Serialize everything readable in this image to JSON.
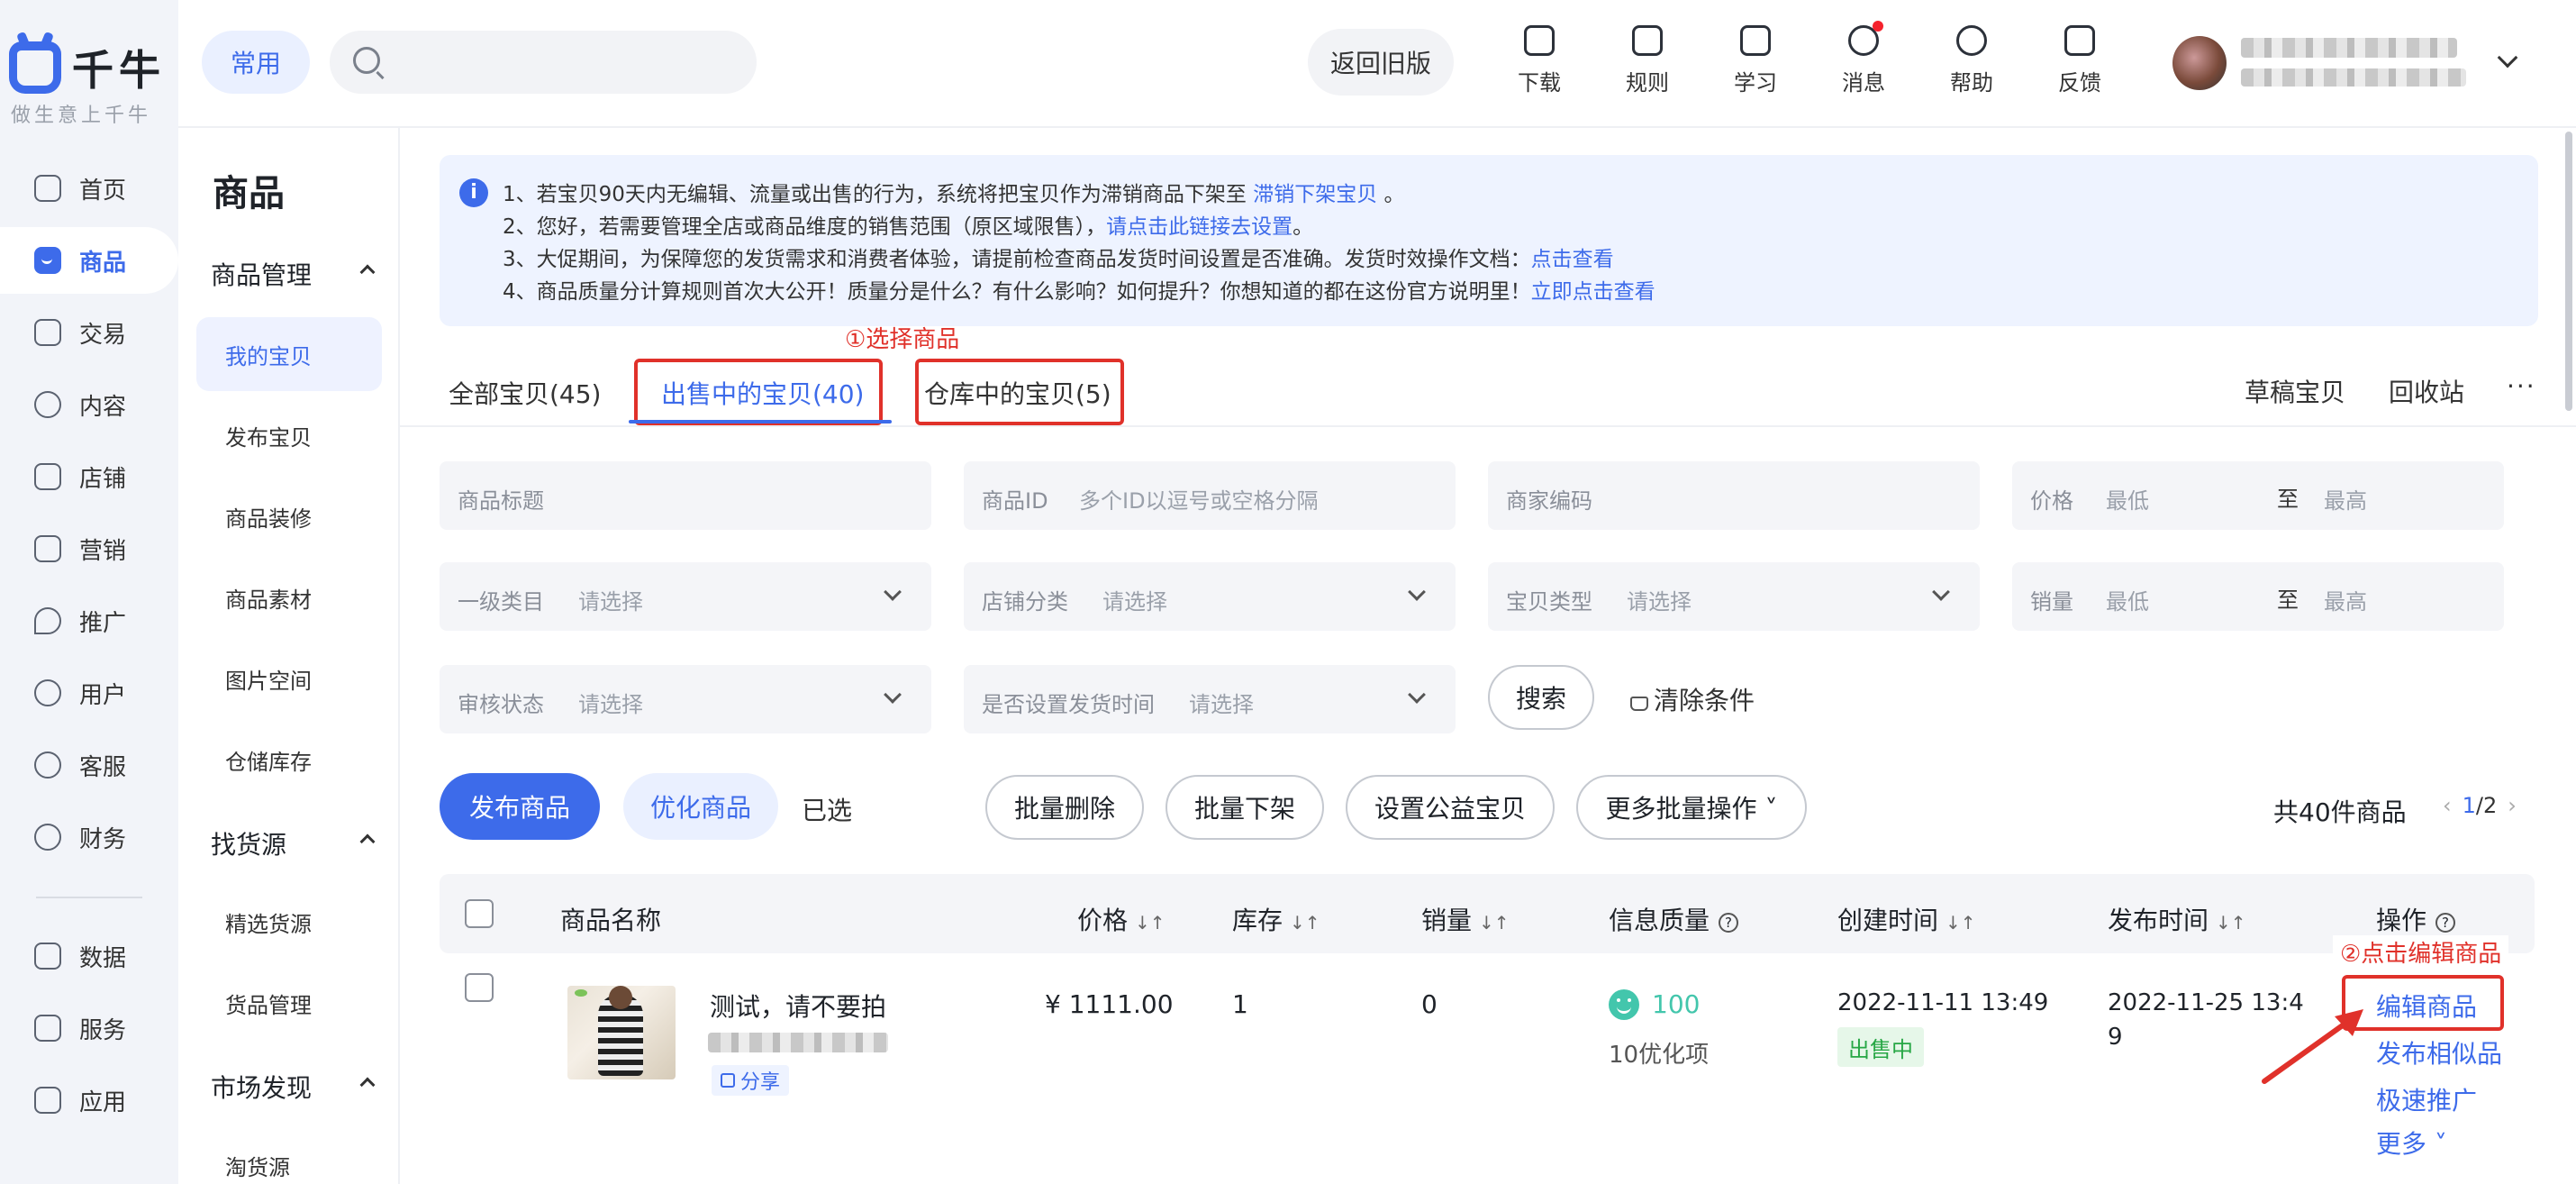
{
  "brand": {
    "name": "千牛",
    "slogan": "做生意上千牛"
  },
  "rail": {
    "items": [
      {
        "label": "首页",
        "icon": "home-icon"
      },
      {
        "label": "商品",
        "icon": "goods-icon"
      },
      {
        "label": "交易",
        "icon": "trade-icon"
      },
      {
        "label": "内容",
        "icon": "content-icon"
      },
      {
        "label": "店铺",
        "icon": "shop-icon"
      },
      {
        "label": "营销",
        "icon": "marketing-icon"
      },
      {
        "label": "推广",
        "icon": "promote-icon"
      },
      {
        "label": "用户",
        "icon": "user-icon"
      },
      {
        "label": "客服",
        "icon": "service-icon"
      },
      {
        "label": "财务",
        "icon": "finance-icon"
      },
      {
        "label": "数据",
        "icon": "data-icon"
      },
      {
        "label": "服务",
        "icon": "services-icon"
      },
      {
        "label": "应用",
        "icon": "apps-icon"
      }
    ],
    "active": "商品"
  },
  "topbar": {
    "common": "常用",
    "search_placeholder": "",
    "old_version": "返回旧版",
    "tools": [
      {
        "label": "下载",
        "icon": "download-icon"
      },
      {
        "label": "规则",
        "icon": "rules-icon"
      },
      {
        "label": "学习",
        "icon": "learn-icon"
      },
      {
        "label": "消息",
        "icon": "message-icon"
      },
      {
        "label": "帮助",
        "icon": "help-icon"
      },
      {
        "label": "反馈",
        "icon": "feedback-icon"
      }
    ]
  },
  "subnav": {
    "title": "商品",
    "groups": [
      {
        "label": "商品管理",
        "items": [
          "我的宝贝",
          "发布宝贝",
          "商品装修",
          "商品素材",
          "图片空间",
          "仓储库存"
        ]
      },
      {
        "label": "找货源",
        "items": [
          "精选货源",
          "货品管理"
        ]
      },
      {
        "label": "市场发现",
        "items": [
          "淘货源"
        ]
      }
    ],
    "active": "我的宝贝"
  },
  "notice": {
    "l1": "1、若宝贝90天内无编辑、流量或出售的行为，系统将把宝贝作为滞销商品下架至",
    "l1_link": "滞销下架宝贝",
    "l1_end": "。",
    "l2": "2、您好，若需要管理全店或商品维度的销售范围（原区域限售），",
    "l2_link": "请点击此链接去设置",
    "l2_end": "。",
    "l3": "3、大促期间，为保障您的发货需求和消费者体验，请提前检查商品发货时间设置是否准确。发货时效操作文档：",
    "l3_link": "点击查看",
    "l4": "4、商品质量分计算规则首次大公开！质量分是什么？有什么影响？如何提升？你想知道的都在这份官方说明里！",
    "l4_link": "立即点击查看"
  },
  "tabs": {
    "all": "全部宝贝(45)",
    "sale": "出售中的宝贝(40)",
    "warehouse": "仓库中的宝贝(5)",
    "draft": "草稿宝贝",
    "recycle": "回收站",
    "more": "···"
  },
  "annotations": {
    "step1": "①选择商品",
    "step2": "②点击编辑商品"
  },
  "filters": {
    "title_ph": "商品标题",
    "id_label": "商品ID",
    "id_ph": "多个ID以逗号或空格分隔",
    "code_ph": "商家编码",
    "price_label": "价格",
    "min": "最低",
    "to": "至",
    "max": "最高",
    "cat_label": "一级类目",
    "select_ph": "请选择",
    "shopcat_label": "店铺分类",
    "type_label": "宝贝类型",
    "sales_label": "销量",
    "audit_label": "审核状态",
    "ship_label": "是否设置发货时间",
    "search_btn": "搜索",
    "clear_btn": "清除条件"
  },
  "actions": {
    "publish": "发布商品",
    "optimize": "优化商品",
    "selected": "已选",
    "batch_delete": "批量删除",
    "batch_offshelf": "批量下架",
    "charity": "设置公益宝贝",
    "more_batch": "更多批量操作 ˅",
    "total": "共40件商品",
    "page_cur": "1",
    "page_total": "/2"
  },
  "table": {
    "headers": {
      "name": "商品名称",
      "price": "价格",
      "stock": "库存",
      "sales": "销量",
      "quality": "信息质量",
      "created": "创建时间",
      "published": "发布时间",
      "ops": "操作"
    },
    "sort_glyph": "↓↑",
    "rows": [
      {
        "name": "测试，请不要拍",
        "share": "分享",
        "price": "¥ 1111.00",
        "stock": "1",
        "sales": "0",
        "quality_score": "100",
        "quality_tip": "10优化项",
        "created": "2022-11-11 13:49",
        "status": "出售中",
        "published_1": "2022-11-25 13:4",
        "published_2": "9",
        "ops": [
          "编辑商品",
          "发布相似品",
          "极速推广",
          "更多 ˅"
        ]
      }
    ]
  },
  "colors": {
    "accent": "#3d6bea",
    "annotation": "#e0312a",
    "status_ok": "#27a745"
  }
}
